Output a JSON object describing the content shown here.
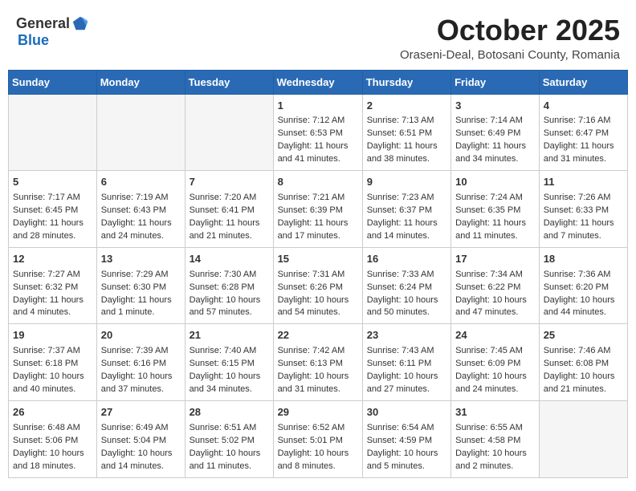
{
  "logo": {
    "general": "General",
    "blue": "Blue"
  },
  "header": {
    "month": "October 2025",
    "location": "Oraseni-Deal, Botosani County, Romania"
  },
  "days_of_week": [
    "Sunday",
    "Monday",
    "Tuesday",
    "Wednesday",
    "Thursday",
    "Friday",
    "Saturday"
  ],
  "weeks": [
    [
      {
        "day": "",
        "sunrise": "",
        "sunset": "",
        "daylight": ""
      },
      {
        "day": "",
        "sunrise": "",
        "sunset": "",
        "daylight": ""
      },
      {
        "day": "",
        "sunrise": "",
        "sunset": "",
        "daylight": ""
      },
      {
        "day": "1",
        "sunrise": "Sunrise: 7:12 AM",
        "sunset": "Sunset: 6:53 PM",
        "daylight": "Daylight: 11 hours and 41 minutes."
      },
      {
        "day": "2",
        "sunrise": "Sunrise: 7:13 AM",
        "sunset": "Sunset: 6:51 PM",
        "daylight": "Daylight: 11 hours and 38 minutes."
      },
      {
        "day": "3",
        "sunrise": "Sunrise: 7:14 AM",
        "sunset": "Sunset: 6:49 PM",
        "daylight": "Daylight: 11 hours and 34 minutes."
      },
      {
        "day": "4",
        "sunrise": "Sunrise: 7:16 AM",
        "sunset": "Sunset: 6:47 PM",
        "daylight": "Daylight: 11 hours and 31 minutes."
      }
    ],
    [
      {
        "day": "5",
        "sunrise": "Sunrise: 7:17 AM",
        "sunset": "Sunset: 6:45 PM",
        "daylight": "Daylight: 11 hours and 28 minutes."
      },
      {
        "day": "6",
        "sunrise": "Sunrise: 7:19 AM",
        "sunset": "Sunset: 6:43 PM",
        "daylight": "Daylight: 11 hours and 24 minutes."
      },
      {
        "day": "7",
        "sunrise": "Sunrise: 7:20 AM",
        "sunset": "Sunset: 6:41 PM",
        "daylight": "Daylight: 11 hours and 21 minutes."
      },
      {
        "day": "8",
        "sunrise": "Sunrise: 7:21 AM",
        "sunset": "Sunset: 6:39 PM",
        "daylight": "Daylight: 11 hours and 17 minutes."
      },
      {
        "day": "9",
        "sunrise": "Sunrise: 7:23 AM",
        "sunset": "Sunset: 6:37 PM",
        "daylight": "Daylight: 11 hours and 14 minutes."
      },
      {
        "day": "10",
        "sunrise": "Sunrise: 7:24 AM",
        "sunset": "Sunset: 6:35 PM",
        "daylight": "Daylight: 11 hours and 11 minutes."
      },
      {
        "day": "11",
        "sunrise": "Sunrise: 7:26 AM",
        "sunset": "Sunset: 6:33 PM",
        "daylight": "Daylight: 11 hours and 7 minutes."
      }
    ],
    [
      {
        "day": "12",
        "sunrise": "Sunrise: 7:27 AM",
        "sunset": "Sunset: 6:32 PM",
        "daylight": "Daylight: 11 hours and 4 minutes."
      },
      {
        "day": "13",
        "sunrise": "Sunrise: 7:29 AM",
        "sunset": "Sunset: 6:30 PM",
        "daylight": "Daylight: 11 hours and 1 minute."
      },
      {
        "day": "14",
        "sunrise": "Sunrise: 7:30 AM",
        "sunset": "Sunset: 6:28 PM",
        "daylight": "Daylight: 10 hours and 57 minutes."
      },
      {
        "day": "15",
        "sunrise": "Sunrise: 7:31 AM",
        "sunset": "Sunset: 6:26 PM",
        "daylight": "Daylight: 10 hours and 54 minutes."
      },
      {
        "day": "16",
        "sunrise": "Sunrise: 7:33 AM",
        "sunset": "Sunset: 6:24 PM",
        "daylight": "Daylight: 10 hours and 50 minutes."
      },
      {
        "day": "17",
        "sunrise": "Sunrise: 7:34 AM",
        "sunset": "Sunset: 6:22 PM",
        "daylight": "Daylight: 10 hours and 47 minutes."
      },
      {
        "day": "18",
        "sunrise": "Sunrise: 7:36 AM",
        "sunset": "Sunset: 6:20 PM",
        "daylight": "Daylight: 10 hours and 44 minutes."
      }
    ],
    [
      {
        "day": "19",
        "sunrise": "Sunrise: 7:37 AM",
        "sunset": "Sunset: 6:18 PM",
        "daylight": "Daylight: 10 hours and 40 minutes."
      },
      {
        "day": "20",
        "sunrise": "Sunrise: 7:39 AM",
        "sunset": "Sunset: 6:16 PM",
        "daylight": "Daylight: 10 hours and 37 minutes."
      },
      {
        "day": "21",
        "sunrise": "Sunrise: 7:40 AM",
        "sunset": "Sunset: 6:15 PM",
        "daylight": "Daylight: 10 hours and 34 minutes."
      },
      {
        "day": "22",
        "sunrise": "Sunrise: 7:42 AM",
        "sunset": "Sunset: 6:13 PM",
        "daylight": "Daylight: 10 hours and 31 minutes."
      },
      {
        "day": "23",
        "sunrise": "Sunrise: 7:43 AM",
        "sunset": "Sunset: 6:11 PM",
        "daylight": "Daylight: 10 hours and 27 minutes."
      },
      {
        "day": "24",
        "sunrise": "Sunrise: 7:45 AM",
        "sunset": "Sunset: 6:09 PM",
        "daylight": "Daylight: 10 hours and 24 minutes."
      },
      {
        "day": "25",
        "sunrise": "Sunrise: 7:46 AM",
        "sunset": "Sunset: 6:08 PM",
        "daylight": "Daylight: 10 hours and 21 minutes."
      }
    ],
    [
      {
        "day": "26",
        "sunrise": "Sunrise: 6:48 AM",
        "sunset": "Sunset: 5:06 PM",
        "daylight": "Daylight: 10 hours and 18 minutes."
      },
      {
        "day": "27",
        "sunrise": "Sunrise: 6:49 AM",
        "sunset": "Sunset: 5:04 PM",
        "daylight": "Daylight: 10 hours and 14 minutes."
      },
      {
        "day": "28",
        "sunrise": "Sunrise: 6:51 AM",
        "sunset": "Sunset: 5:02 PM",
        "daylight": "Daylight: 10 hours and 11 minutes."
      },
      {
        "day": "29",
        "sunrise": "Sunrise: 6:52 AM",
        "sunset": "Sunset: 5:01 PM",
        "daylight": "Daylight: 10 hours and 8 minutes."
      },
      {
        "day": "30",
        "sunrise": "Sunrise: 6:54 AM",
        "sunset": "Sunset: 4:59 PM",
        "daylight": "Daylight: 10 hours and 5 minutes."
      },
      {
        "day": "31",
        "sunrise": "Sunrise: 6:55 AM",
        "sunset": "Sunset: 4:58 PM",
        "daylight": "Daylight: 10 hours and 2 minutes."
      },
      {
        "day": "",
        "sunrise": "",
        "sunset": "",
        "daylight": ""
      }
    ]
  ]
}
